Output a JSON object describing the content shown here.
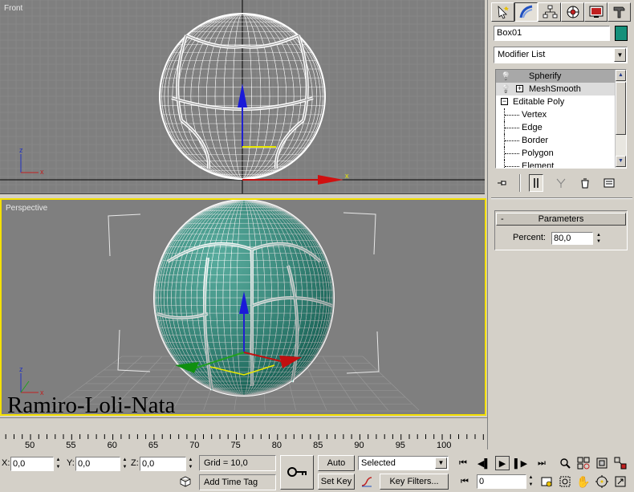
{
  "viewports": {
    "front_label": "Front",
    "perspective_label": "Perspective",
    "front_axis": {
      "z": "z",
      "x": "x"
    },
    "persp_axis": {
      "z": "z",
      "x": "x"
    },
    "gizmo_x_label": "x"
  },
  "watermark": "Ramiro-Loli-Nata",
  "command_panel": {
    "tabs": [
      "create-icon",
      "modify-icon",
      "hierarchy-icon",
      "motion-icon",
      "display-icon",
      "utilities-icon"
    ],
    "object_name": "Box01",
    "object_color": "#15907a",
    "modifier_list": "Modifier List",
    "stack": [
      {
        "label": "Spherify",
        "type": "modifier",
        "selected": true
      },
      {
        "label": "MeshSmooth",
        "type": "modifier-expandable"
      },
      {
        "label": "Editable Poly",
        "type": "base"
      },
      {
        "label": "Vertex",
        "type": "sub"
      },
      {
        "label": "Edge",
        "type": "sub"
      },
      {
        "label": "Border",
        "type": "sub"
      },
      {
        "label": "Polygon",
        "type": "sub"
      },
      {
        "label": "Element",
        "type": "sub"
      }
    ],
    "rollout": {
      "toggle": "-",
      "title": "Parameters",
      "percent_label": "Percent:",
      "percent_value": "80,0"
    }
  },
  "timeline": {
    "ticks": [
      "50",
      "55",
      "60",
      "65",
      "70",
      "75",
      "80",
      "85",
      "90",
      "95",
      "100"
    ]
  },
  "status": {
    "x_label": "X:",
    "x_value": "0,0",
    "y_label": "Y:",
    "y_value": "0,0",
    "z_label": "Z:",
    "z_value": "0,0",
    "grid": "Grid = 10,0",
    "add_time_tag": "Add Time Tag",
    "auto_key": "Auto Key",
    "set_key": "Set Key",
    "selected": "Selected",
    "key_filters": "Key Filters...",
    "frame": "0"
  }
}
